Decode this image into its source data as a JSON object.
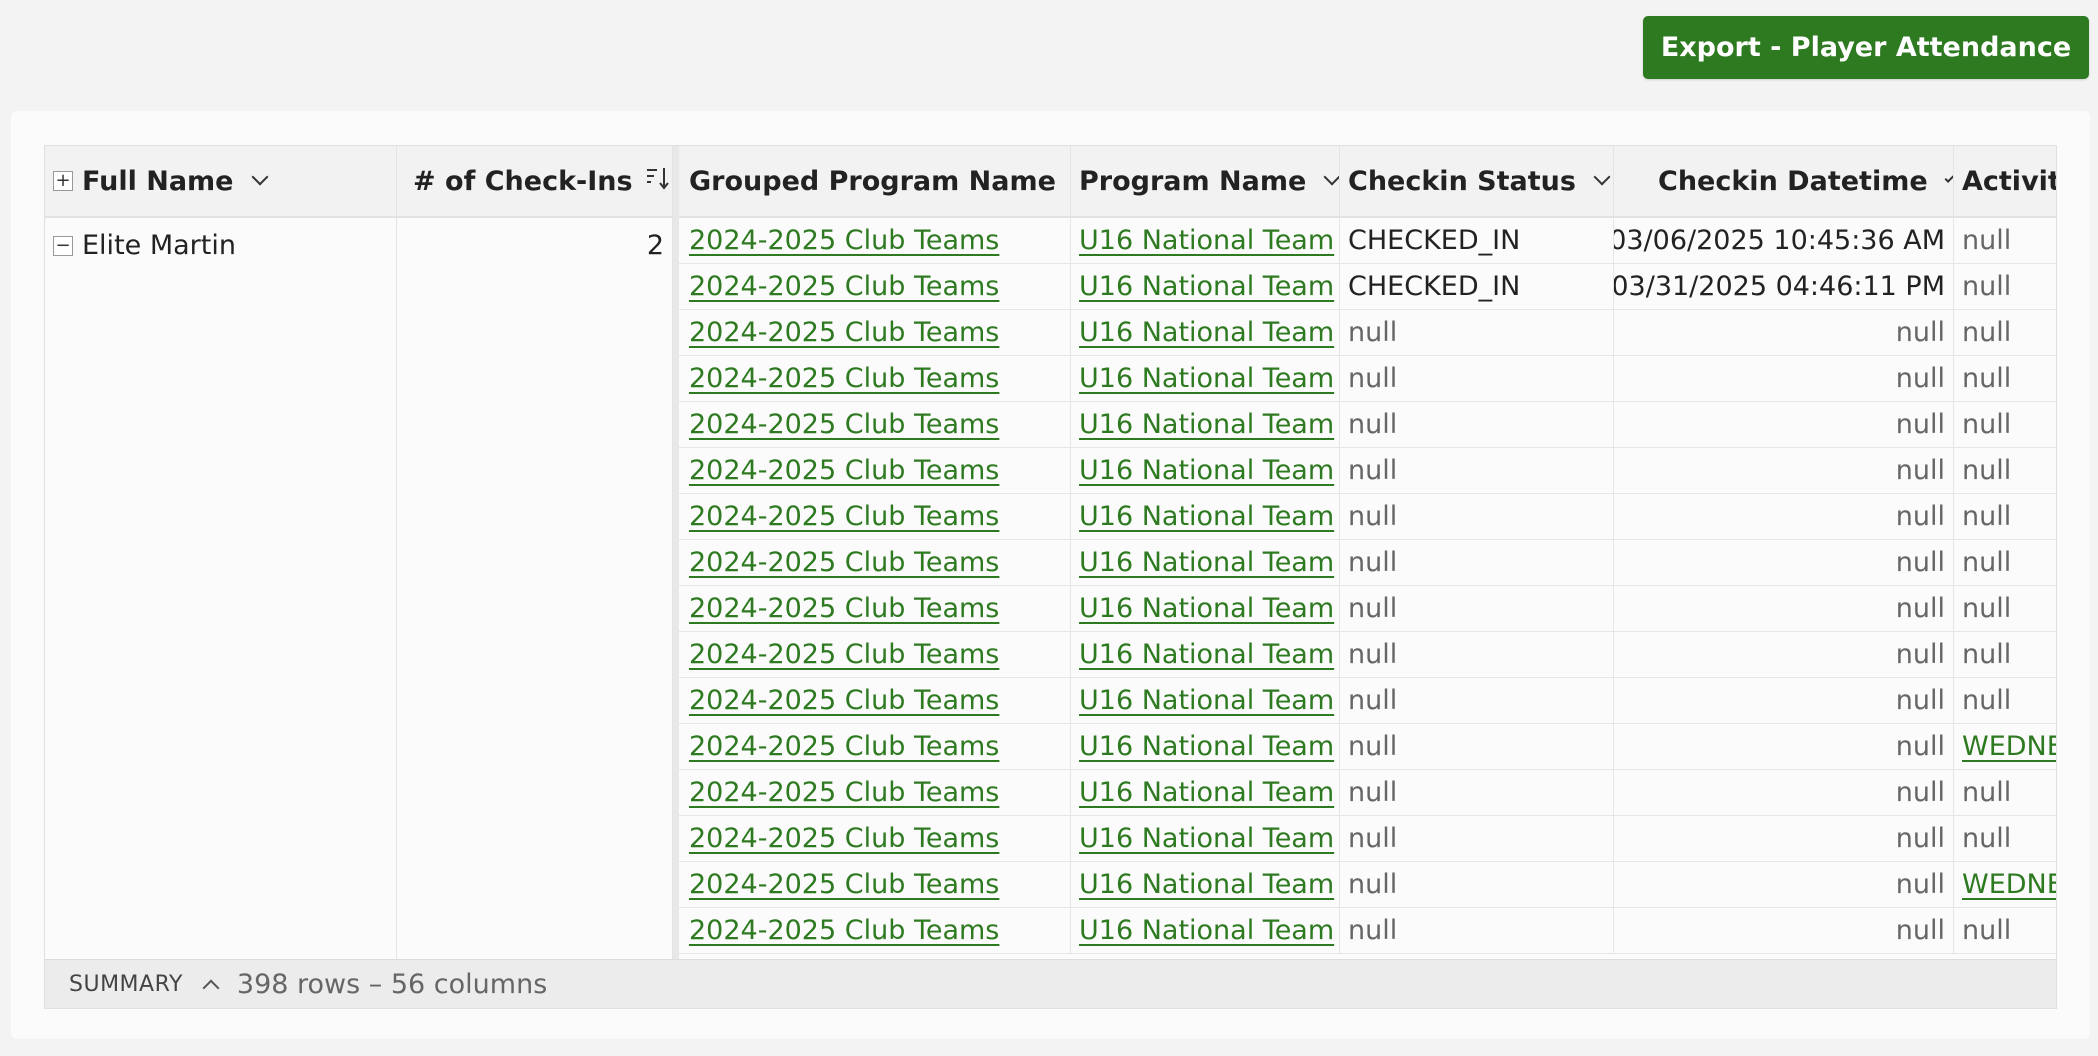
{
  "toolbar": {
    "export_label": "Export - Player Attendance"
  },
  "columns": {
    "full_name": "Full Name",
    "checkins": "# of Check-Ins",
    "grouped_program": "Grouped Program Name",
    "program": "Program Name",
    "checkin_status": "Checkin Status",
    "checkin_datetime": "Checkin Datetime",
    "activity": "Activit"
  },
  "group": {
    "name": "Elite Martin",
    "checkins": "2"
  },
  "rows": [
    {
      "grouped": "2024-2025 Club Teams",
      "program": "U16 National Team",
      "status": "CHECKED_IN",
      "datetime": "03/06/2025 10:45:36 AM",
      "activity": "null"
    },
    {
      "grouped": "2024-2025 Club Teams",
      "program": "U16 National Team",
      "status": "CHECKED_IN",
      "datetime": "03/31/2025 04:46:11 PM",
      "activity": "null"
    },
    {
      "grouped": "2024-2025 Club Teams",
      "program": "U16 National Team",
      "status": "null",
      "datetime": "null",
      "activity": "null"
    },
    {
      "grouped": "2024-2025 Club Teams",
      "program": "U16 National Team",
      "status": "null",
      "datetime": "null",
      "activity": "null"
    },
    {
      "grouped": "2024-2025 Club Teams",
      "program": "U16 National Team",
      "status": "null",
      "datetime": "null",
      "activity": "null"
    },
    {
      "grouped": "2024-2025 Club Teams",
      "program": "U16 National Team",
      "status": "null",
      "datetime": "null",
      "activity": "null"
    },
    {
      "grouped": "2024-2025 Club Teams",
      "program": "U16 National Team",
      "status": "null",
      "datetime": "null",
      "activity": "null"
    },
    {
      "grouped": "2024-2025 Club Teams",
      "program": "U16 National Team",
      "status": "null",
      "datetime": "null",
      "activity": "null"
    },
    {
      "grouped": "2024-2025 Club Teams",
      "program": "U16 National Team",
      "status": "null",
      "datetime": "null",
      "activity": "null"
    },
    {
      "grouped": "2024-2025 Club Teams",
      "program": "U16 National Team",
      "status": "null",
      "datetime": "null",
      "activity": "null"
    },
    {
      "grouped": "2024-2025 Club Teams",
      "program": "U16 National Team",
      "status": "null",
      "datetime": "null",
      "activity": "null"
    },
    {
      "grouped": "2024-2025 Club Teams",
      "program": "U16 National Team",
      "status": "null",
      "datetime": "null",
      "activity": "WEDNE"
    },
    {
      "grouped": "2024-2025 Club Teams",
      "program": "U16 National Team",
      "status": "null",
      "datetime": "null",
      "activity": "null"
    },
    {
      "grouped": "2024-2025 Club Teams",
      "program": "U16 National Team",
      "status": "null",
      "datetime": "null",
      "activity": "null"
    },
    {
      "grouped": "2024-2025 Club Teams",
      "program": "U16 National Team",
      "status": "null",
      "datetime": "null",
      "activity": "WEDNE"
    },
    {
      "grouped": "2024-2025 Club Teams",
      "program": "U16 National Team",
      "status": "null",
      "datetime": "null",
      "activity": "null"
    }
  ],
  "footer": {
    "summary_label": "SUMMARY",
    "counts": "398 rows – 56 columns"
  },
  "icons": {
    "expand": "+",
    "collapse": "−",
    "sort": "sort-descending-icon",
    "chevron": "chevron-down-icon"
  },
  "colors": {
    "accent": "#2e7a21",
    "background": "#f3f3f3"
  }
}
